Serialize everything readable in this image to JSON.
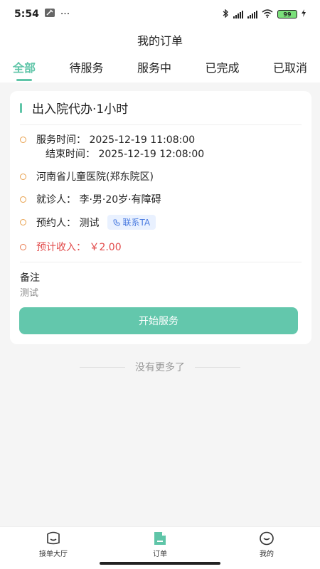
{
  "status_bar": {
    "time": "5:54",
    "more": "···",
    "battery": "99"
  },
  "header": {
    "title": "我的订单"
  },
  "tabs": [
    {
      "label": "全部",
      "active": true
    },
    {
      "label": "待服务"
    },
    {
      "label": "服务中"
    },
    {
      "label": "已完成"
    },
    {
      "label": "已取消"
    }
  ],
  "order": {
    "title": "出入院代办·1小时",
    "service_time": "服务时间： 2025-12-19 11:08:00",
    "end_time": "结束时间： 2025-12-19 12:08:00",
    "hospital": "河南省儿童医院(郑东院区)",
    "patient": "就诊人： 李·男·20岁·有障碍",
    "booker": "预约人： 测试",
    "contact_label": "联系TA",
    "income": "预计收入： ￥2.00",
    "remark_label": "备注",
    "remark_value": "测试",
    "start_button": "开始服务"
  },
  "list": {
    "no_more": "没有更多了"
  },
  "bottom_nav": [
    {
      "label": "接单大厅"
    },
    {
      "label": "订单",
      "active": true
    },
    {
      "label": "我的"
    }
  ],
  "colors": {
    "accent": "#5fc5a8",
    "button": "#63c7ac",
    "income": "#e24c4c",
    "dot": "#e8a04c"
  }
}
